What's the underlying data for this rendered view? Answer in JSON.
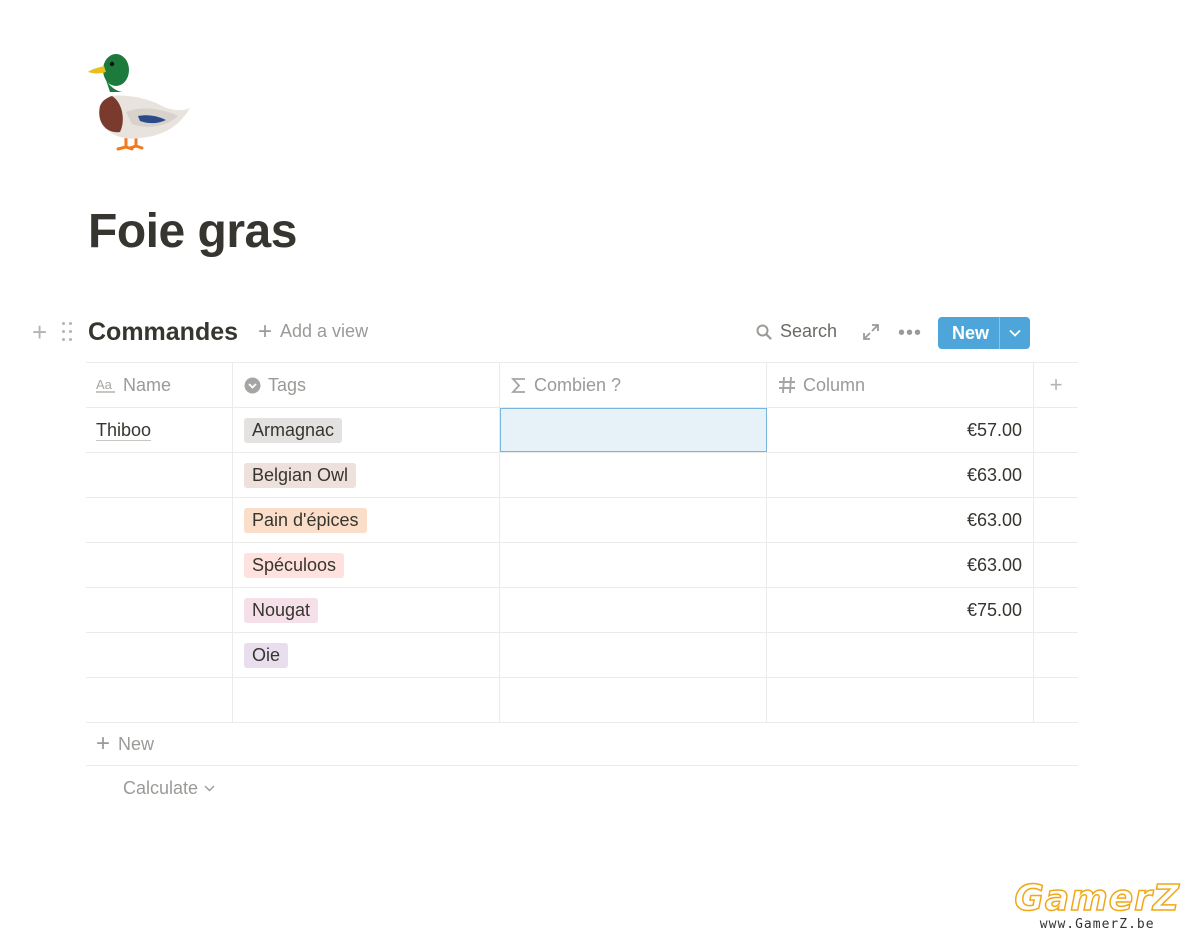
{
  "page": {
    "icon": "duck-emoji",
    "title": "Foie gras"
  },
  "database": {
    "title": "Commandes",
    "add_view_label": "Add a view",
    "search_label": "Search",
    "new_button_label": "New",
    "columns": [
      {
        "label": "Name",
        "icon": "text-aa-icon"
      },
      {
        "label": "Tags",
        "icon": "select-chevron-icon"
      },
      {
        "label": "Combien ?",
        "icon": "sigma-formula-icon"
      },
      {
        "label": "Column",
        "icon": "hash-number-icon"
      }
    ],
    "rows": [
      {
        "name": "Thiboo",
        "tag": "Armagnac",
        "tag_color": "#e3e2e0",
        "combien": "",
        "column": "€57.00"
      },
      {
        "name": "",
        "tag": "Belgian Owl",
        "tag_color": "#eee0da",
        "combien": "",
        "column": "€63.00"
      },
      {
        "name": "",
        "tag": "Pain d'épices",
        "tag_color": "#fadec9",
        "combien": "",
        "column": "€63.00"
      },
      {
        "name": "",
        "tag": "Spéculoos",
        "tag_color": "#ffe2dd",
        "combien": "",
        "column": "€63.00"
      },
      {
        "name": "",
        "tag": "Nougat",
        "tag_color": "#f5e0e9",
        "combien": "",
        "column": "€75.00"
      },
      {
        "name": "",
        "tag": "Oie",
        "tag_color": "#e8deee",
        "combien": "",
        "column": ""
      }
    ],
    "new_row_label": "New",
    "calculate_label": "Calculate"
  },
  "watermark": {
    "logo": "GamerZ",
    "url": "www.GamerZ.be"
  },
  "colors": {
    "accent": "#4ea5d9",
    "selection": "#e6f1f8"
  }
}
